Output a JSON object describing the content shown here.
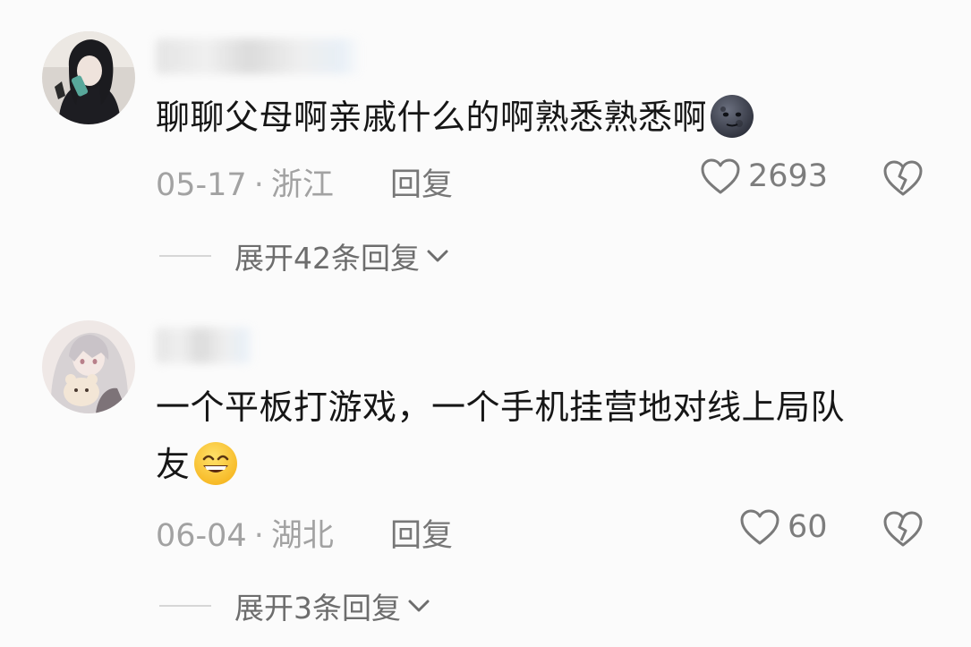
{
  "comments": [
    {
      "text": "聊聊父母啊亲戚什么的啊熟悉熟悉啊",
      "emoji_icon": "new-moon-face-emoji",
      "date": "05-17",
      "location": "浙江",
      "separator": "·",
      "reply_label": "回复",
      "likes": "2693",
      "expand_label": "展开42条回复"
    },
    {
      "text_line1": "一个平板打游戏，一个手机挂营地对线上局队",
      "text_line2": "友",
      "emoji_icon": "grinning-squinting-face-emoji",
      "date": "06-04",
      "location": "湖北",
      "separator": "·",
      "reply_label": "回复",
      "likes": "60",
      "expand_label": "展开3条回复"
    }
  ],
  "icons": {
    "like": "heart-outline-icon",
    "dislike": "broken-heart-outline-icon",
    "expand": "chevron-down-icon"
  },
  "colors": {
    "background": "#fbfbfb",
    "text": "#161616",
    "meta": "#a2a2a2",
    "action": "#777777"
  }
}
